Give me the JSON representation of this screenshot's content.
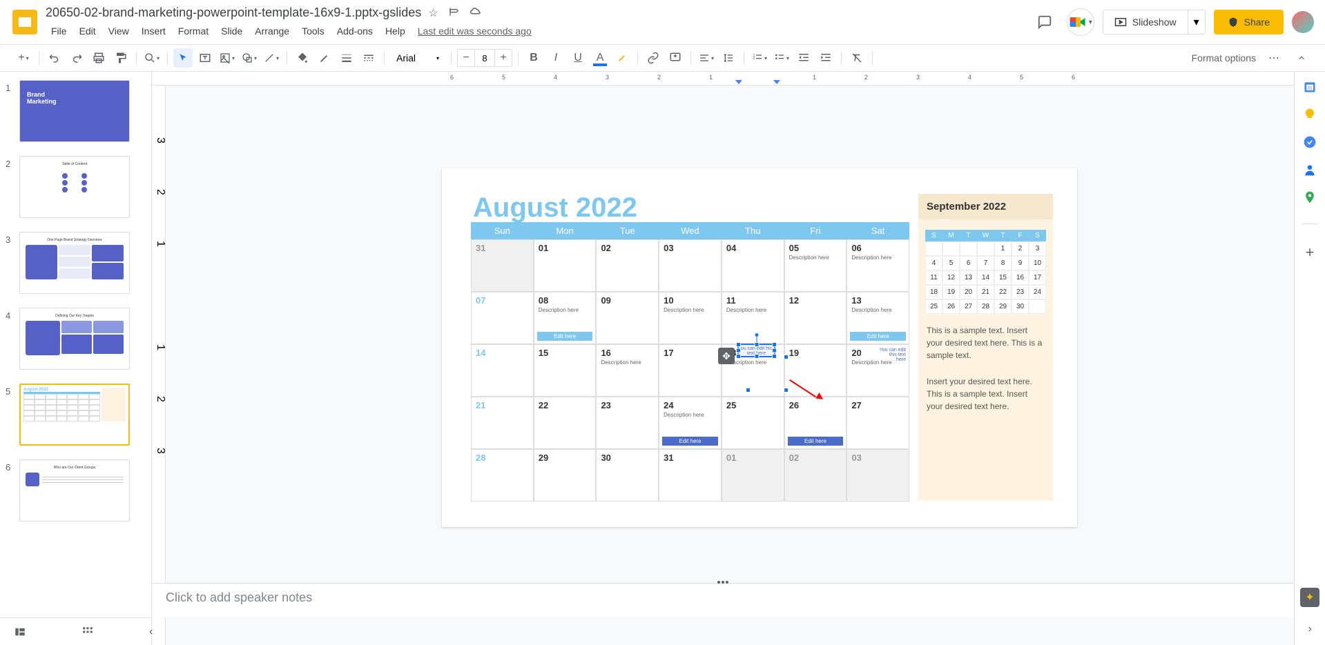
{
  "doc": {
    "title": "20650-02-brand-marketing-powerpoint-template-16x9-1.pptx-gslides",
    "last_edit": "Last edit was seconds ago"
  },
  "menu": {
    "file": "File",
    "edit": "Edit",
    "view": "View",
    "insert": "Insert",
    "format": "Format",
    "slide": "Slide",
    "arrange": "Arrange",
    "tools": "Tools",
    "addons": "Add-ons",
    "help": "Help"
  },
  "header": {
    "slideshow": "Slideshow",
    "share": "Share"
  },
  "toolbar": {
    "font": "Arial",
    "font_size": "8",
    "format_options": "Format options"
  },
  "thumbs": {
    "s1": {
      "title1": "Brand",
      "title2": "Marketing"
    },
    "s2": {
      "title": "Table of Content"
    },
    "s3": {
      "title": "One Page Brand Strategy Overview"
    },
    "s4": {
      "title": "Defining Our Key Targets"
    },
    "s5": {
      "title": "August 2022"
    },
    "s6": {
      "title": "Who are Our Client Groups"
    }
  },
  "slide": {
    "title": "August 2022",
    "days": [
      "Sun",
      "Mon",
      "Tue",
      "Wed",
      "Thu",
      "Fri",
      "Sat"
    ],
    "desc_text": "Description here",
    "edit_text": "Edit here",
    "edit_note": "You can edit this text here",
    "editing": "ou can edit his text here",
    "rows": [
      [
        {
          "d": "31",
          "gray": true
        },
        {
          "d": "01"
        },
        {
          "d": "02"
        },
        {
          "d": "03"
        },
        {
          "d": "04"
        },
        {
          "d": "05",
          "desc": true
        },
        {
          "d": "06",
          "desc": true
        }
      ],
      [
        {
          "d": "07",
          "sun": true
        },
        {
          "d": "08",
          "desc": true,
          "edit": "light"
        },
        {
          "d": "09"
        },
        {
          "d": "10",
          "desc": true
        },
        {
          "d": "11",
          "desc": true
        },
        {
          "d": "12"
        },
        {
          "d": "13",
          "desc": true,
          "edit": "light"
        }
      ],
      [
        {
          "d": "14",
          "sun": true
        },
        {
          "d": "15"
        },
        {
          "d": "16",
          "desc": true
        },
        {
          "d": "17"
        },
        {
          "d": "18",
          "desc": true,
          "selected": true
        },
        {
          "d": "19"
        },
        {
          "d": "20",
          "desc": true,
          "note": true
        }
      ],
      [
        {
          "d": "21",
          "sun": true
        },
        {
          "d": "22"
        },
        {
          "d": "23"
        },
        {
          "d": "24",
          "desc": true,
          "edit": "blue"
        },
        {
          "d": "25"
        },
        {
          "d": "26",
          "edit": "blue"
        },
        {
          "d": "27"
        }
      ],
      [
        {
          "d": "28",
          "sun": true
        },
        {
          "d": "29"
        },
        {
          "d": "30"
        },
        {
          "d": "31"
        },
        {
          "d": "01",
          "gray": true
        },
        {
          "d": "02",
          "gray": true
        },
        {
          "d": "03",
          "gray": true
        }
      ]
    ],
    "sept": {
      "title": "September 2022",
      "days": [
        "S",
        "M",
        "T",
        "W",
        "T",
        "F",
        "S"
      ],
      "rows": [
        [
          "",
          "",
          "",
          "",
          "1",
          "2",
          "3"
        ],
        [
          "4",
          "5",
          "6",
          "7",
          "8",
          "9",
          "10"
        ],
        [
          "11",
          "12",
          "13",
          "14",
          "15",
          "16",
          "17"
        ],
        [
          "18",
          "19",
          "20",
          "21",
          "22",
          "23",
          "24"
        ],
        [
          "25",
          "26",
          "27",
          "28",
          "29",
          "30",
          ""
        ]
      ],
      "text1": "This is a sample text. Insert your desired text here. This is a sample text.",
      "text2": "Insert your desired text here. This is a sample text. Insert your desired text here."
    }
  },
  "notes": {
    "placeholder": "Click to add speaker notes"
  }
}
